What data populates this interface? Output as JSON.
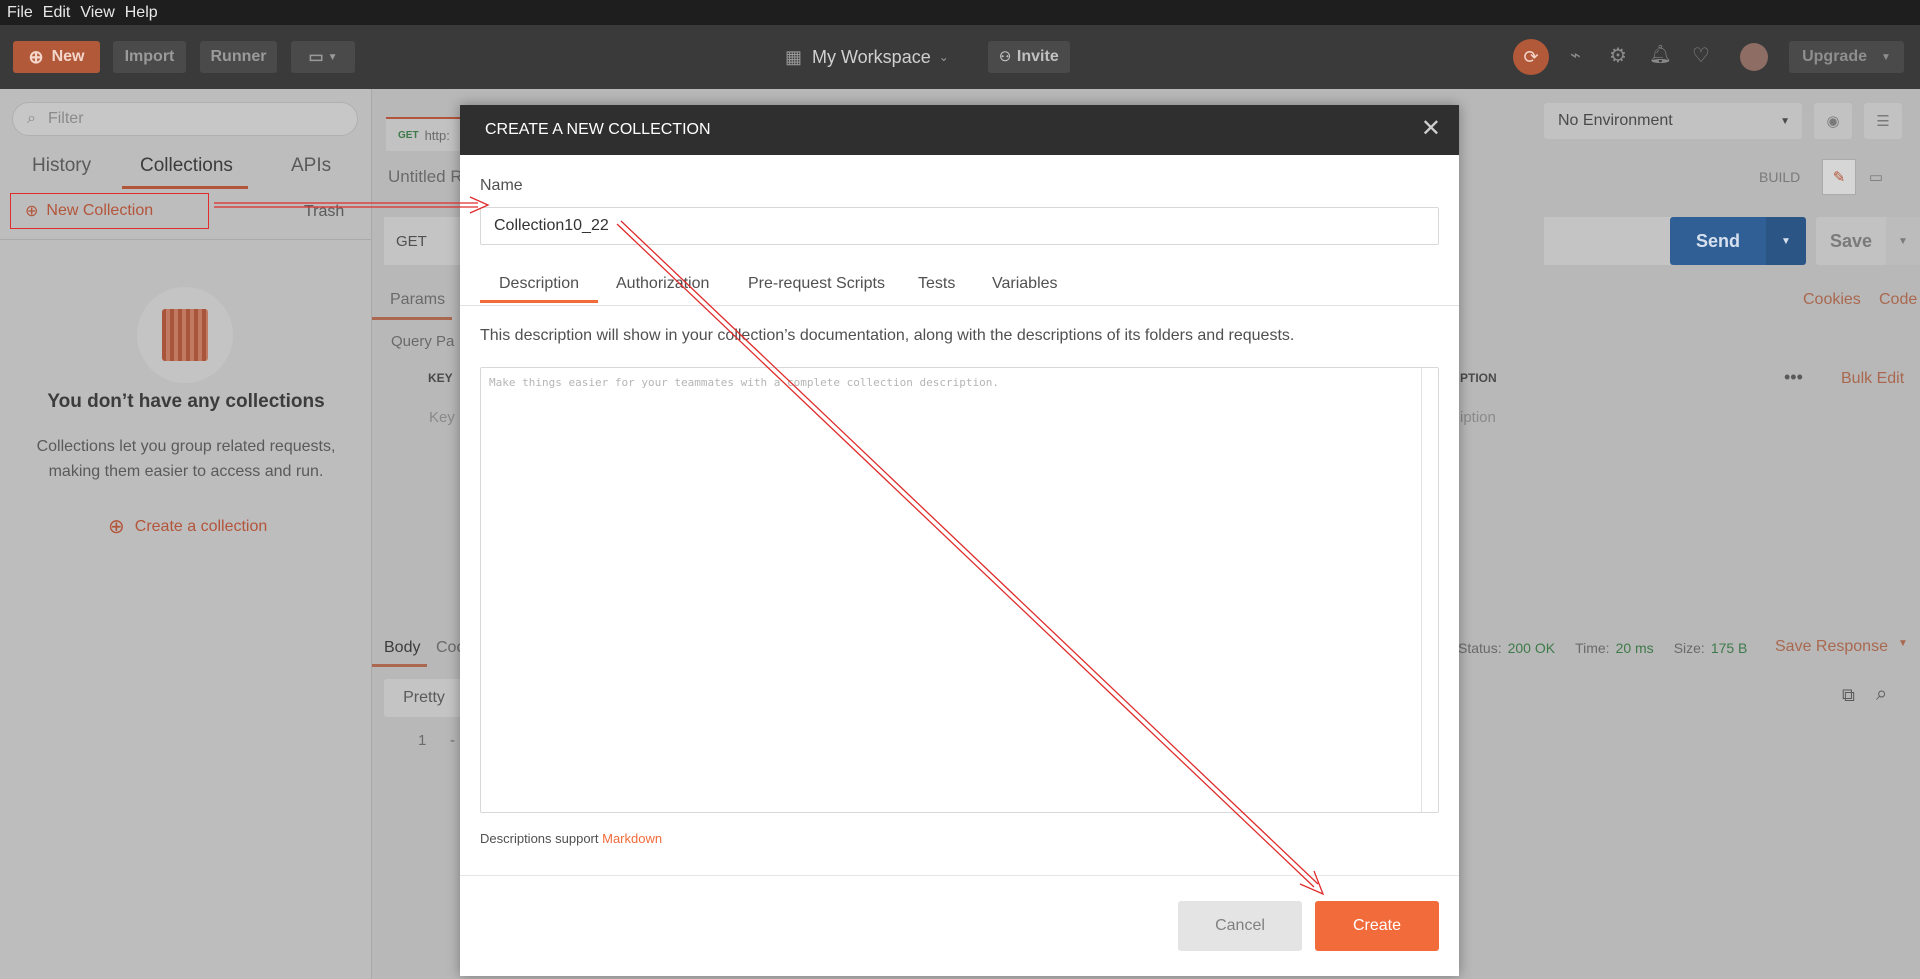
{
  "menu": [
    "File",
    "Edit",
    "View",
    "Help"
  ],
  "header": {
    "new_label": "New",
    "import_label": "Import",
    "runner_label": "Runner",
    "workspace_label": "My Workspace",
    "invite_label": "Invite",
    "upgrade_label": "Upgrade",
    "accent": "#f26b3a"
  },
  "sidebar": {
    "filter_placeholder": "Filter",
    "tabs": [
      "History",
      "Collections",
      "APIs"
    ],
    "new_collection_label": "New Collection",
    "trash_label": "Trash",
    "empty_title": "You don’t have any collections",
    "empty_desc": "Collections let you group related requests, making them easier to access and run.",
    "create_link": "Create a collection"
  },
  "main": {
    "tab_method": "GET",
    "tab_url": "http:",
    "request_title": "Untitled R",
    "method": "GET",
    "environment": "No Environment",
    "build_label": "BUILD",
    "send_label": "Send",
    "save_label": "Save",
    "params_label": "Params",
    "cookies_label": "Cookies",
    "code_label": "Code",
    "query_params_label": "Query Pa",
    "key_header": "KEY",
    "desc_header_fragment": "PTION",
    "bulk_edit_label": "Bulk Edit",
    "key_placeholder": "Key",
    "desc_placeholder_fragment": "iption",
    "body_label": "Body",
    "cookies_tab_fragment": "Coo",
    "status_label": "Status:",
    "status_value": "200 OK",
    "time_label": "Time:",
    "time_value": "20 ms",
    "size_label": "Size:",
    "size_value": "175 B",
    "save_response_label": "Save Response",
    "pretty_label": "Pretty",
    "line_number": "1",
    "line_content": "-"
  },
  "modal": {
    "title": "CREATE A NEW COLLECTION",
    "name_label": "Name",
    "name_value": "Collection10_22",
    "tabs": [
      "Description",
      "Authorization",
      "Pre-request Scripts",
      "Tests",
      "Variables"
    ],
    "description_info": "This description will show in your collection’s documentation, along with the descriptions of its folders and requests.",
    "description_placeholder": "Make things easier for your teammates with a complete collection description.",
    "markdown_note": "Descriptions support",
    "markdown_link": "Markdown",
    "cancel_label": "Cancel",
    "create_label": "Create"
  },
  "annotation_color": "#e02c2c"
}
